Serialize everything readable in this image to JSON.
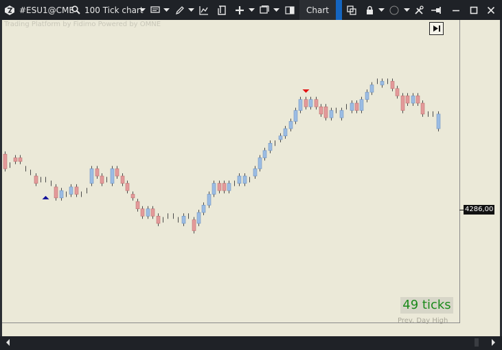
{
  "toolbar": {
    "symbol": "#ESU1@CME",
    "chart_type": "100 Tick chart",
    "chart_button": "Chart"
  },
  "chart": {
    "watermark": "Trading Platform by Fidimo  Powered by OMNE",
    "last_price": "4286,00",
    "ticks_remaining": "49 ticks",
    "prev_day_high_label": "Prev. Day High",
    "colors": {
      "up": "#9bbce3",
      "down": "#e39a9a",
      "background": "#ebe9d8",
      "ticks_text": "#1a8a1a"
    },
    "candles": [
      {
        "t": "down",
        "o": 26,
        "c": 22
      },
      {
        "t": "doji",
        "o": 23,
        "c": 23
      },
      {
        "t": "down",
        "o": 24,
        "c": 25
      },
      {
        "t": "down",
        "o": 24,
        "c": 25
      },
      {
        "t": "doji",
        "o": 22,
        "c": 22
      },
      {
        "t": "doji",
        "o": 21,
        "c": 21
      },
      {
        "t": "down",
        "o": 20,
        "c": 18
      },
      {
        "t": "doji",
        "o": 19,
        "c": 19
      },
      {
        "t": "doji",
        "o": 19,
        "c": 19
      },
      {
        "t": "doji",
        "o": 18,
        "c": 18
      },
      {
        "t": "down",
        "o": 17,
        "c": 14
      },
      {
        "t": "up",
        "o": 14,
        "c": 16
      },
      {
        "t": "doji",
        "o": 15,
        "c": 15
      },
      {
        "t": "up",
        "o": 15,
        "c": 17
      },
      {
        "t": "down",
        "o": 17,
        "c": 15
      },
      {
        "t": "doji",
        "o": 15,
        "c": 15
      },
      {
        "t": "doji",
        "o": 16,
        "c": 16
      },
      {
        "t": "up",
        "o": 18,
        "c": 22
      },
      {
        "t": "down",
        "o": 22,
        "c": 20
      },
      {
        "t": "down",
        "o": 20,
        "c": 18
      },
      {
        "t": "doji",
        "o": 19,
        "c": 19
      },
      {
        "t": "up",
        "o": 18,
        "c": 22
      },
      {
        "t": "down",
        "o": 22,
        "c": 20
      },
      {
        "t": "down",
        "o": 20,
        "c": 18
      },
      {
        "t": "down",
        "o": 18,
        "c": 16
      },
      {
        "t": "down",
        "o": 15,
        "c": 14
      },
      {
        "t": "down",
        "o": 13,
        "c": 11
      },
      {
        "t": "down",
        "o": 11,
        "c": 9
      },
      {
        "t": "up",
        "o": 11,
        "c": 9
      },
      {
        "t": "down",
        "o": 11,
        "c": 9
      },
      {
        "t": "down",
        "o": 9,
        "c": 7
      },
      {
        "t": "doji",
        "o": 8,
        "c": 8
      },
      {
        "t": "doji",
        "o": 9,
        "c": 9
      },
      {
        "t": "doji",
        "o": 9,
        "c": 9
      },
      {
        "t": "doji",
        "o": 8,
        "c": 8
      },
      {
        "t": "up",
        "o": 7,
        "c": 9
      },
      {
        "t": "doji",
        "o": 9,
        "c": 9
      },
      {
        "t": "down",
        "o": 8,
        "c": 5
      },
      {
        "t": "up",
        "o": 7,
        "c": 10
      },
      {
        "t": "up",
        "o": 10,
        "c": 12
      },
      {
        "t": "up",
        "o": 12,
        "c": 15
      },
      {
        "t": "up",
        "o": 15,
        "c": 18
      },
      {
        "t": "down",
        "o": 18,
        "c": 16
      },
      {
        "t": "down",
        "o": 18,
        "c": 16
      },
      {
        "t": "up",
        "o": 16,
        "c": 18
      },
      {
        "t": "doji",
        "o": 18,
        "c": 18
      },
      {
        "t": "up",
        "o": 18,
        "c": 20
      },
      {
        "t": "up",
        "o": 18,
        "c": 20
      },
      {
        "t": "doji",
        "o": 19,
        "c": 19
      },
      {
        "t": "up",
        "o": 20,
        "c": 22
      },
      {
        "t": "up",
        "o": 22,
        "c": 25
      },
      {
        "t": "up",
        "o": 25,
        "c": 27
      },
      {
        "t": "up",
        "o": 27,
        "c": 29
      },
      {
        "t": "doji",
        "o": 29,
        "c": 29
      },
      {
        "t": "up",
        "o": 30,
        "c": 31
      },
      {
        "t": "up",
        "o": 31,
        "c": 33
      },
      {
        "t": "up",
        "o": 33,
        "c": 35
      },
      {
        "t": "up",
        "o": 35,
        "c": 38
      },
      {
        "t": "up",
        "o": 38,
        "c": 41
      },
      {
        "t": "down",
        "o": 41,
        "c": 39
      },
      {
        "t": "up",
        "o": 39,
        "c": 41
      },
      {
        "t": "down",
        "o": 41,
        "c": 39
      },
      {
        "t": "down",
        "o": 39,
        "c": 37
      },
      {
        "t": "down",
        "o": 39,
        "c": 36
      },
      {
        "t": "up",
        "o": 36,
        "c": 38
      },
      {
        "t": "doji",
        "o": 38,
        "c": 38
      },
      {
        "t": "up",
        "o": 36,
        "c": 38
      },
      {
        "t": "doji",
        "o": 39,
        "c": 39
      },
      {
        "t": "up",
        "o": 38,
        "c": 40
      },
      {
        "t": "down",
        "o": 40,
        "c": 38
      },
      {
        "t": "up",
        "o": 38,
        "c": 41
      },
      {
        "t": "up",
        "o": 41,
        "c": 43
      },
      {
        "t": "up",
        "o": 43,
        "c": 45
      },
      {
        "t": "doji",
        "o": 46,
        "c": 46
      },
      {
        "t": "up",
        "o": 45,
        "c": 46
      },
      {
        "t": "doji",
        "o": 46,
        "c": 46
      },
      {
        "t": "down",
        "o": 46,
        "c": 44
      },
      {
        "t": "down",
        "o": 44,
        "c": 42
      },
      {
        "t": "down",
        "o": 42,
        "c": 38
      },
      {
        "t": "down",
        "o": 42,
        "c": 40
      },
      {
        "t": "up",
        "o": 40,
        "c": 42
      },
      {
        "t": "down",
        "o": 42,
        "c": 40
      },
      {
        "t": "down",
        "o": 40,
        "c": 37
      },
      {
        "t": "doji",
        "o": 37,
        "c": 37
      },
      {
        "t": "doji",
        "o": 37,
        "c": 37
      },
      {
        "t": "up",
        "o": 33,
        "c": 37
      }
    ],
    "markers": [
      {
        "type": "buy",
        "index": 8,
        "price": 17
      },
      {
        "type": "sell",
        "index": 59,
        "price": 40
      }
    ]
  }
}
